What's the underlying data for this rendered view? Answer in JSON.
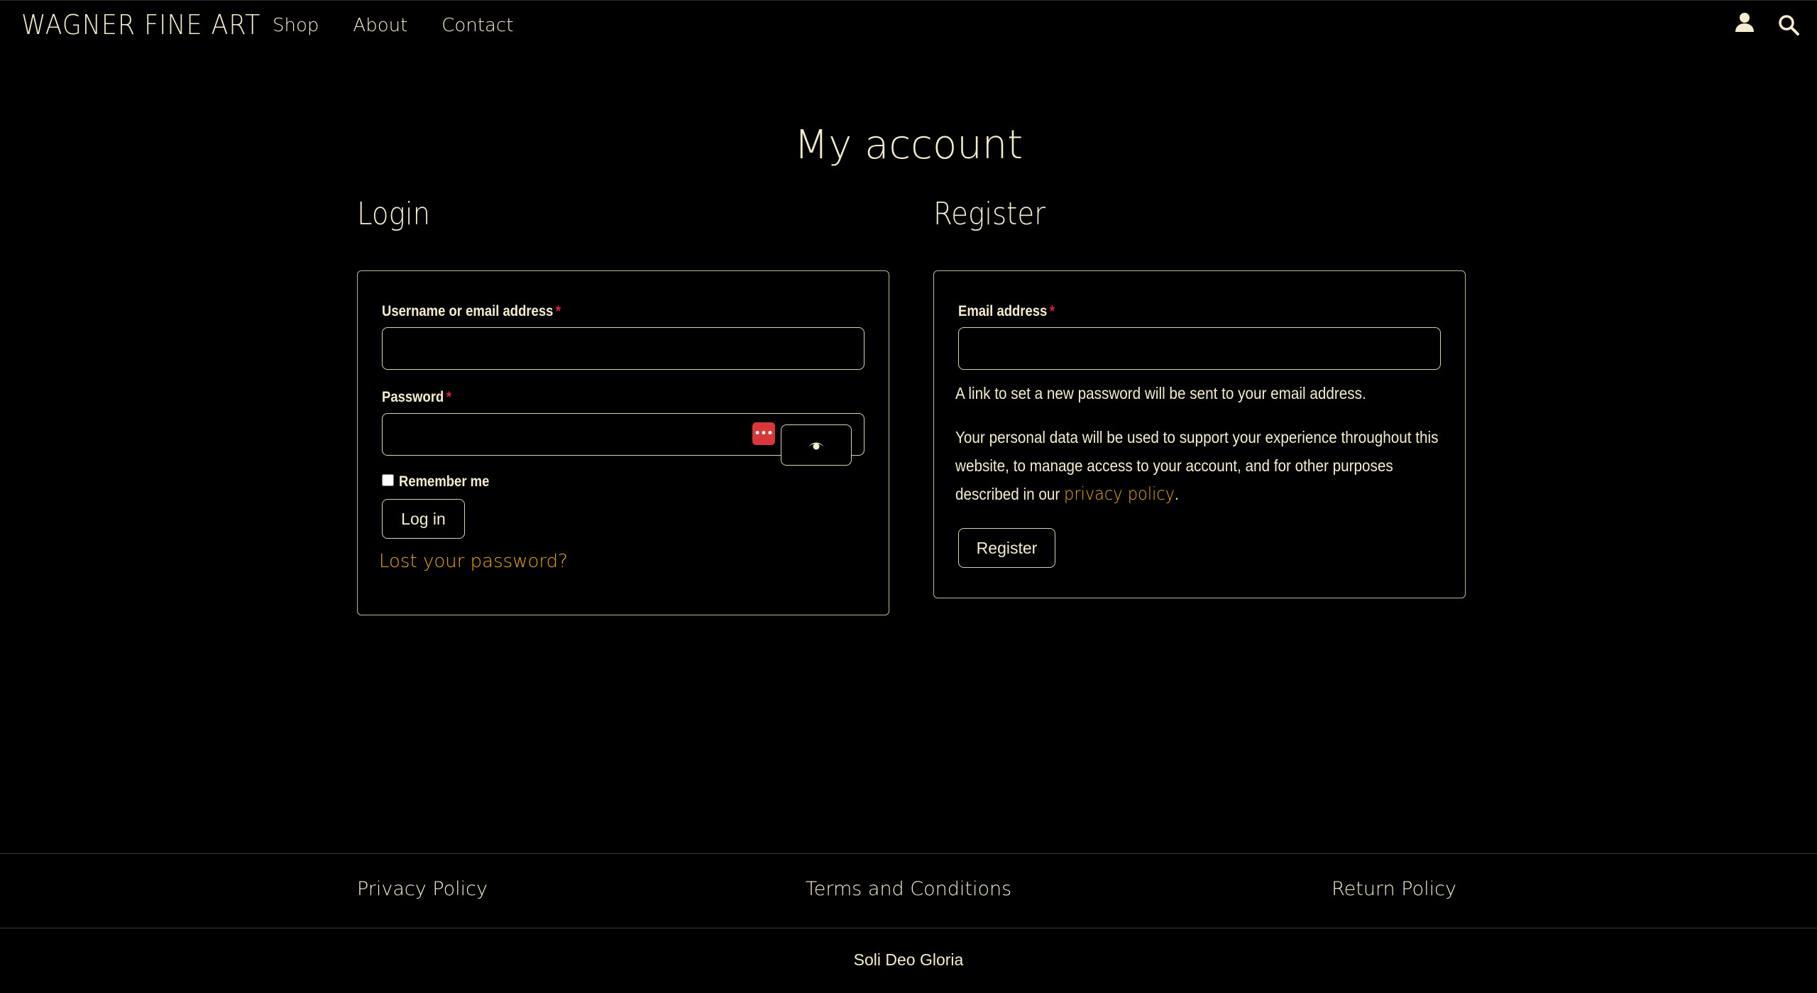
{
  "header": {
    "logo": "WAGNER FINE ART",
    "nav": [
      {
        "label": "Shop"
      },
      {
        "label": "About"
      },
      {
        "label": "Contact"
      }
    ],
    "account_icon": "user-icon",
    "search_icon": "search-icon"
  },
  "page": {
    "title": "My account"
  },
  "login": {
    "heading": "Login",
    "username_label": "Username or email address",
    "username_value": "",
    "password_label": "Password",
    "password_value": "",
    "required_mark": "*",
    "password_manager_icon": "password-manager-icon",
    "show_password_icon": "eye-icon",
    "remember_label": "Remember me",
    "remember_checked": false,
    "login_button": "Log in",
    "lost_password_link": "Lost your password?"
  },
  "register": {
    "heading": "Register",
    "email_label": "Email address",
    "email_value": "",
    "required_mark": "*",
    "info_text": "A link to set a new password will be sent to your email address.",
    "privacy_text_before": "Your personal data will be used to support your experience throughout this website, to manage access to your account, and for other purposes described in our ",
    "privacy_link": "privacy policy",
    "privacy_text_after": ".",
    "register_button": "Register"
  },
  "footer": {
    "links": [
      {
        "label": "Privacy Policy"
      },
      {
        "label": "Terms and Conditions"
      },
      {
        "label": "Return Policy"
      }
    ],
    "copyright": "Soli Deo Gloria"
  },
  "colors": {
    "background": "#000000",
    "text": "#f5ecd0",
    "link": "#e8a712",
    "required": "#e0223a",
    "password_manager": "#d9383a"
  }
}
